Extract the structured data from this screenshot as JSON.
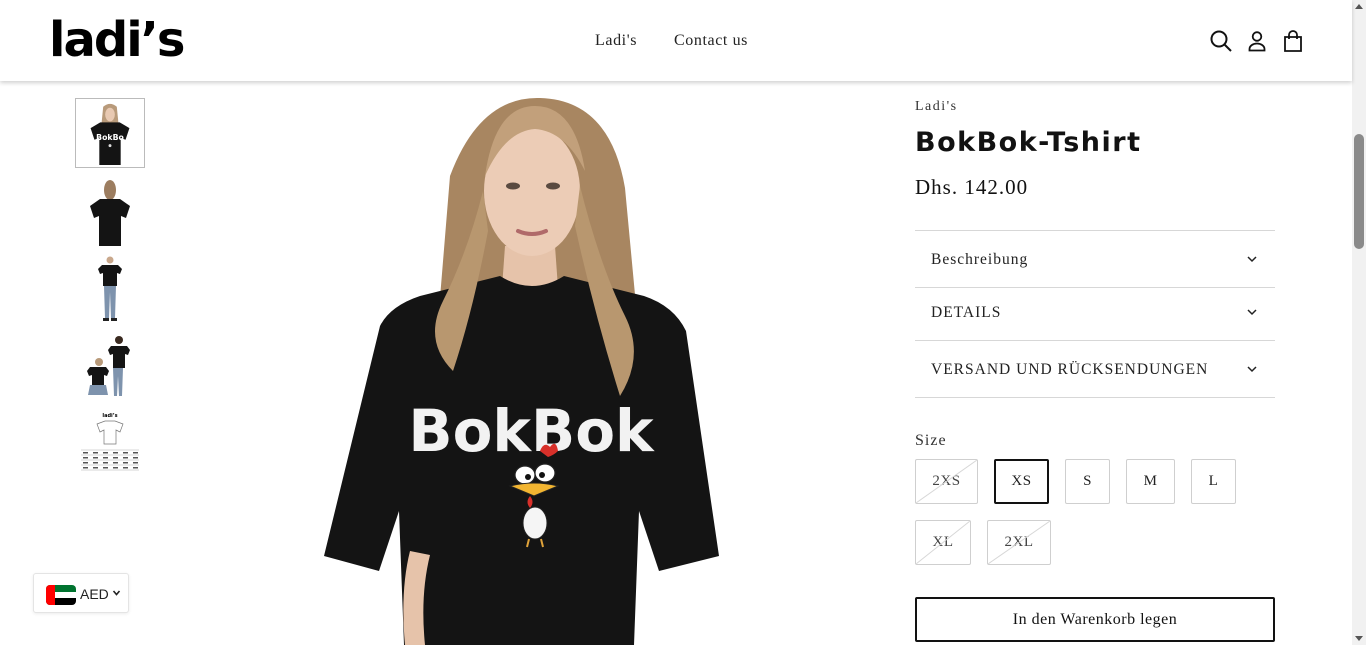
{
  "header": {
    "logo_text": "ladi’s",
    "nav": [
      {
        "label": "Ladi's"
      },
      {
        "label": "Contact us"
      }
    ],
    "icons": [
      "search-icon",
      "account-icon",
      "cart-icon"
    ]
  },
  "gallery": {
    "thumbnails": [
      {
        "name": "front-view",
        "selected": true
      },
      {
        "name": "back-view",
        "selected": false
      },
      {
        "name": "male-model-full",
        "selected": false
      },
      {
        "name": "couple-view",
        "selected": false
      },
      {
        "name": "size-chart",
        "selected": false
      }
    ],
    "main_print_text": "BokBok"
  },
  "product": {
    "vendor": "Ladi's",
    "title": "BokBok-Tshirt",
    "price": "Dhs. 142.00",
    "accordions": [
      {
        "label": "Beschreibung"
      },
      {
        "label": "DETAILS"
      },
      {
        "label": "VERSAND UND RÜCKSENDUNGEN"
      }
    ],
    "size_label": "Size",
    "sizes": [
      {
        "label": "2XS",
        "state": "unavailable"
      },
      {
        "label": "XS",
        "state": "selected"
      },
      {
        "label": "S",
        "state": "available"
      },
      {
        "label": "M",
        "state": "available"
      },
      {
        "label": "L",
        "state": "available"
      },
      {
        "label": "XL",
        "state": "unavailable"
      },
      {
        "label": "2XL",
        "state": "unavailable"
      }
    ],
    "add_to_cart": "In den Warenkorb legen"
  },
  "currency": {
    "code": "AED",
    "flag": "uae-flag-icon"
  },
  "colors": {
    "text": "#121212",
    "border": "#d7d7d7",
    "shirt": "#141414",
    "flag_red": "#ff0000",
    "flag_green": "#00732f"
  }
}
